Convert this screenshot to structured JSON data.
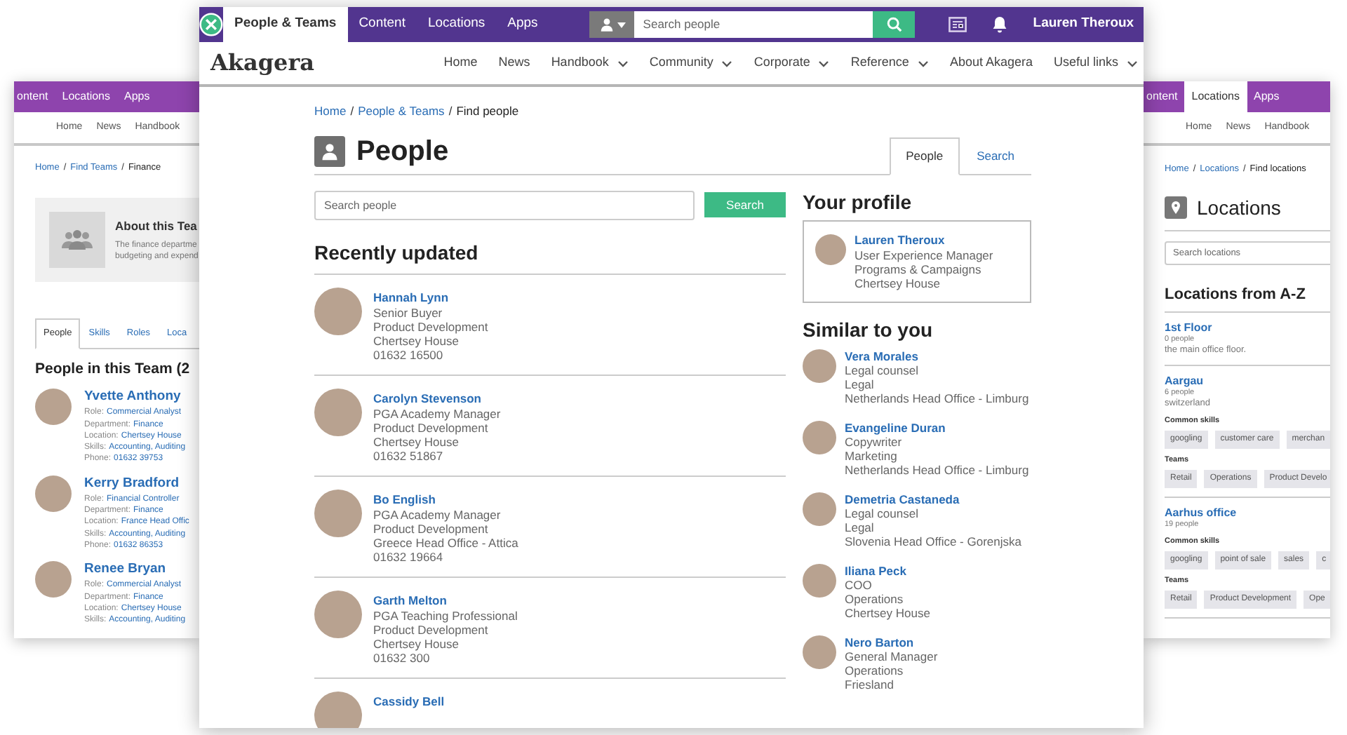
{
  "left_window": {
    "top_nav": [
      {
        "label": "ontent",
        "selected": false
      },
      {
        "label": "Locations",
        "selected": false
      },
      {
        "label": "Apps",
        "selected": false
      }
    ],
    "main_nav": [
      "Home",
      "News",
      "Handbook"
    ],
    "breadcrumb": {
      "separator": "/",
      "items": [
        {
          "label": "Home",
          "current": false
        },
        {
          "label": "Find Teams",
          "current": false
        },
        {
          "label": "Finance",
          "current": true
        }
      ]
    },
    "about": {
      "title": "About this Tea",
      "lines": [
        "The finance departme",
        "budgeting and expend"
      ]
    },
    "tabs": [
      {
        "label": "People",
        "selected": true
      },
      {
        "label": "Skills",
        "selected": false
      },
      {
        "label": "Roles",
        "selected": false
      },
      {
        "label": "Loca",
        "selected": false
      }
    ],
    "heading": "People in this Team (2",
    "members": [
      {
        "name": "Yvette Anthony",
        "fields": [
          {
            "label": "Role:",
            "value": "Commercial Analyst"
          },
          {
            "label": "Department:",
            "value": "Finance"
          },
          {
            "label": "Location:",
            "value": "Chertsey House"
          },
          {
            "label": "Skills:",
            "value": "Accounting, Auditing"
          },
          {
            "label": "Phone:",
            "value": "01632 39753"
          }
        ]
      },
      {
        "name": "Kerry Bradford",
        "fields": [
          {
            "label": "Role:",
            "value": "Financial Controller"
          },
          {
            "label": "Department:",
            "value": "Finance"
          },
          {
            "label": "Location:",
            "value": "France Head Offic"
          },
          {
            "label": "Skills:",
            "value": "Accounting, Auditing"
          },
          {
            "label": "Phone:",
            "value": "01632 86353"
          }
        ]
      },
      {
        "name": "Renee Bryan",
        "fields": [
          {
            "label": "Role:",
            "value": "Commercial Analyst"
          },
          {
            "label": "Department:",
            "value": "Finance"
          },
          {
            "label": "Location:",
            "value": "Chertsey House"
          },
          {
            "label": "Skills:",
            "value": "Accounting, Auditing"
          }
        ]
      }
    ]
  },
  "main_window": {
    "top_tabs": [
      {
        "label": "People & Teams",
        "selected": true
      },
      {
        "label": "Content",
        "selected": false
      },
      {
        "label": "Locations",
        "selected": false
      },
      {
        "label": "Apps",
        "selected": false
      }
    ],
    "search": {
      "placeholder": "Search people"
    },
    "user_name": "Lauren Theroux",
    "brand": "Akagera",
    "nav": [
      {
        "label": "Home",
        "dropdown": false
      },
      {
        "label": "News",
        "dropdown": false
      },
      {
        "label": "Handbook",
        "dropdown": true
      },
      {
        "label": "Community",
        "dropdown": true
      },
      {
        "label": "Corporate",
        "dropdown": true
      },
      {
        "label": "Reference",
        "dropdown": true
      },
      {
        "label": "About Akagera",
        "dropdown": false
      },
      {
        "label": "Useful links",
        "dropdown": true
      }
    ],
    "breadcrumb": {
      "separator": "/",
      "items": [
        {
          "label": "Home",
          "current": false
        },
        {
          "label": "People & Teams",
          "current": false
        },
        {
          "label": "Find people",
          "current": true
        }
      ]
    },
    "title": "People",
    "view_tabs": [
      {
        "label": "People",
        "selected": true
      },
      {
        "label": "Search",
        "selected": false
      }
    ],
    "people_search": {
      "placeholder": "Search people",
      "button": "Search"
    },
    "recent": {
      "heading": "Recently updated",
      "people": [
        {
          "name": "Hannah Lynn",
          "lines": [
            "Senior Buyer",
            "Product Development",
            "Chertsey House",
            "01632 16500"
          ]
        },
        {
          "name": "Carolyn Stevenson",
          "lines": [
            "PGA Academy Manager",
            "Product Development",
            "Chertsey House",
            "01632 51867"
          ]
        },
        {
          "name": "Bo English",
          "lines": [
            "PGA Academy Manager",
            "Product Development",
            "Greece Head Office - Attica",
            "01632 19664"
          ]
        },
        {
          "name": "Garth Melton",
          "lines": [
            "PGA Teaching Professional",
            "Product Development",
            "Chertsey House",
            "01632 300"
          ]
        },
        {
          "name": "Cassidy Bell"
        }
      ]
    },
    "profile": {
      "heading": "Your profile",
      "name": "Lauren Theroux",
      "lines": [
        "User Experience Manager",
        "Programs & Campaigns",
        "Chertsey House"
      ]
    },
    "similar": {
      "heading": "Similar to you",
      "people": [
        {
          "name": "Vera Morales",
          "lines": [
            "Legal counsel",
            "Legal",
            "Netherlands Head Office - Limburg"
          ]
        },
        {
          "name": "Evangeline Duran",
          "lines": [
            "Copywriter",
            "Marketing",
            "Netherlands Head Office - Limburg"
          ]
        },
        {
          "name": "Demetria Castaneda",
          "lines": [
            "Legal counsel",
            "Legal",
            "Slovenia Head Office - Gorenjska"
          ]
        },
        {
          "name": "Iliana Peck",
          "lines": [
            "COO",
            "Operations",
            "Chertsey House"
          ]
        },
        {
          "name": "Nero Barton",
          "lines": [
            "General Manager",
            "Operations",
            "Friesland"
          ]
        }
      ]
    }
  },
  "right_window": {
    "top_nav": [
      {
        "label": "ontent",
        "selected": false
      },
      {
        "label": "Locations",
        "selected": true
      },
      {
        "label": "Apps",
        "selected": false
      }
    ],
    "main_nav": [
      "Home",
      "News",
      "Handbook"
    ],
    "breadcrumb": {
      "separator": "/",
      "items": [
        {
          "label": "Home",
          "current": false
        },
        {
          "label": "Locations",
          "current": false
        },
        {
          "label": "Find locations",
          "current": true
        }
      ]
    },
    "title": "Locations",
    "search": {
      "placeholder": "Search locations"
    },
    "heading": "Locations from A-Z",
    "locations": [
      {
        "name": "1st Floor",
        "count": "0 people",
        "description": "the main office floor."
      },
      {
        "name": "Aargau",
        "count": "6 people",
        "description": "switzerland",
        "groups": [
          {
            "label": "Common skills",
            "tags": [
              "googling",
              "customer care",
              "merchan"
            ]
          },
          {
            "label": "Teams",
            "tags": [
              "Retail",
              "Operations",
              "Product Develo"
            ]
          }
        ]
      },
      {
        "name": "Aarhus office",
        "count": "19 people",
        "groups": [
          {
            "label": "Common skills",
            "tags": [
              "googling",
              "point of sale",
              "sales",
              "c"
            ]
          },
          {
            "label": "Teams",
            "tags": [
              "Retail",
              "Product Development",
              "Ope"
            ]
          }
        ]
      }
    ]
  }
}
